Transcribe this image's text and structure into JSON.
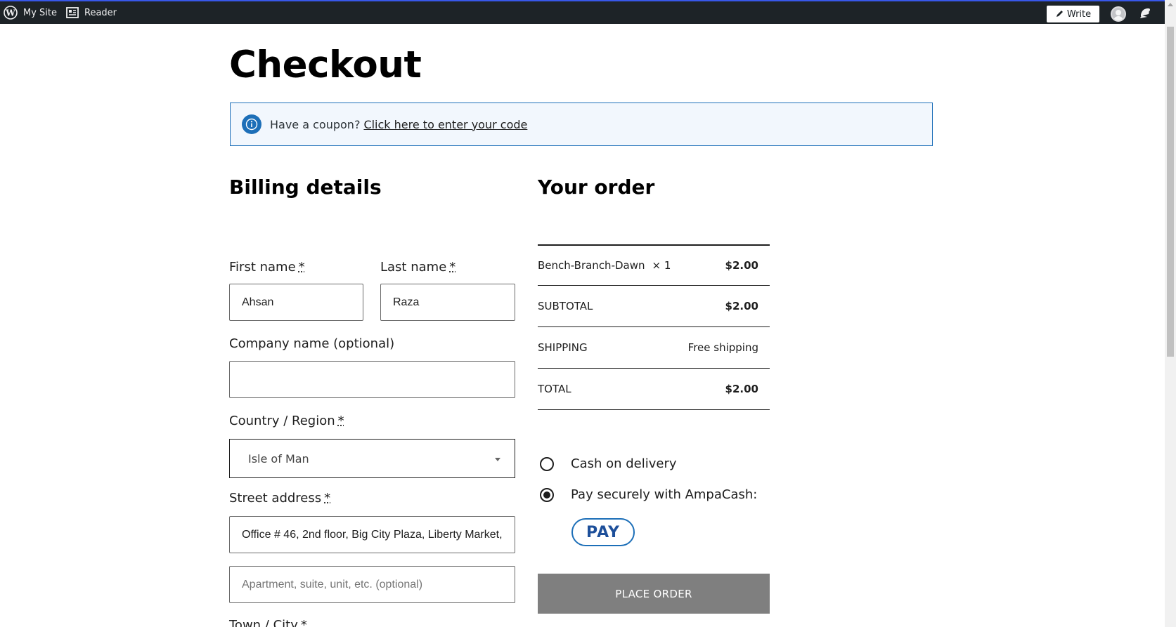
{
  "admin_bar": {
    "my_site_label": "My Site",
    "reader_label": "Reader",
    "write_label": "Write",
    "accent_color": "#3858e9",
    "background_color": "#1d2327"
  },
  "page": {
    "title": "Checkout"
  },
  "coupon": {
    "prompt": "Have a coupon?",
    "link_label": "Click here to enter your code"
  },
  "billing": {
    "heading": "Billing details",
    "first_name": {
      "label": "First name",
      "required_mark": "*",
      "value": "Ahsan"
    },
    "last_name": {
      "label": "Last name",
      "required_mark": "*",
      "value": "Raza"
    },
    "company": {
      "label": "Company name (optional)",
      "value": ""
    },
    "country": {
      "label": "Country / Region",
      "required_mark": "*",
      "value": "Isle of Man"
    },
    "street": {
      "label": "Street address",
      "required_mark": "*",
      "value": "Office # 46, 2nd floor, Big City Plaza, Liberty Market,",
      "apartment_placeholder": "Apartment, suite, unit, etc. (optional)"
    },
    "town": {
      "label": "Town / City",
      "required_mark": "*"
    }
  },
  "order": {
    "heading": "Your order",
    "rows": [
      {
        "label": "Bench-Branch-Dawn",
        "qty": "× 1",
        "value": "$2.00"
      },
      {
        "label": "SUBTOTAL",
        "value": "$2.00"
      },
      {
        "label": "SHIPPING",
        "value": "Free shipping"
      },
      {
        "label": "TOTAL",
        "value": "$2.00"
      }
    ],
    "payment_methods": [
      {
        "label": "Cash on delivery",
        "selected": false
      },
      {
        "label": "Pay securely with AmpaCash:",
        "selected": true
      }
    ],
    "pay_badge_label": "PAY",
    "place_order_label": "PLACE ORDER"
  },
  "icons": {
    "wordpress": "wordpress-logo-icon",
    "reader": "reader-icon",
    "write": "pen-icon",
    "avatar": "avatar-icon",
    "notifications": "bell-icon",
    "info": "info-icon",
    "select_caret": "chevron-down-icon"
  }
}
